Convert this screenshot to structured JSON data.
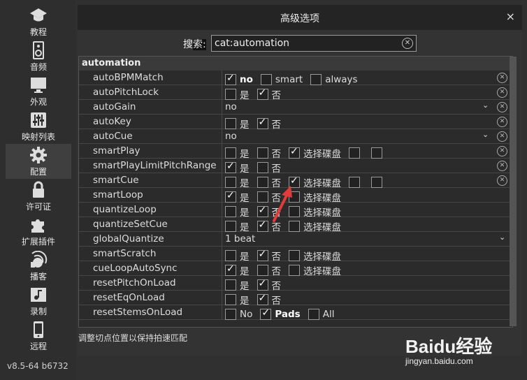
{
  "sidebar": {
    "items": [
      {
        "label": "教程",
        "icon": "graduation-cap-icon"
      },
      {
        "label": "音频",
        "icon": "speaker-icon"
      },
      {
        "label": "外观",
        "icon": "monitor-icon"
      },
      {
        "label": "映射列表",
        "icon": "sliders-icon"
      },
      {
        "label": "配置",
        "icon": "gear-icon"
      },
      {
        "label": "许可证",
        "icon": "lock-icon"
      },
      {
        "label": "扩展插件",
        "icon": "puzzle-icon"
      },
      {
        "label": "播客",
        "icon": "podcast-icon"
      },
      {
        "label": "录制",
        "icon": "music-note-icon"
      },
      {
        "label": "远程",
        "icon": "phone-icon"
      }
    ],
    "active_index": 4,
    "version": "v8.5-64 b6732"
  },
  "dialog": {
    "title": "高级选项",
    "close": "×",
    "search_label_a": "搜",
    "search_label_b": "索:",
    "search_value": "cat:automation",
    "clear": "ⓧ"
  },
  "group": "automation",
  "rows": [
    {
      "name": "autoBPMMatch",
      "type": "opts",
      "opts": [
        {
          "cb": true,
          "text": "no",
          "bold": true
        },
        {
          "cb": false,
          "text": "smart"
        },
        {
          "cb": false,
          "text": "always"
        }
      ],
      "clear": true
    },
    {
      "name": "autoPitchLock",
      "type": "opts",
      "opts": [
        {
          "cb": false,
          "text": "是"
        },
        {
          "cb": true,
          "text": "否"
        }
      ],
      "clear": true
    },
    {
      "name": "autoGain",
      "type": "dropdown",
      "value": "no",
      "clear": true
    },
    {
      "name": "autoKey",
      "type": "opts",
      "opts": [
        {
          "cb": false,
          "text": "是"
        },
        {
          "cb": true,
          "text": "否"
        }
      ],
      "clear": true
    },
    {
      "name": "autoCue",
      "type": "dropdown",
      "value": "no",
      "clear": true
    },
    {
      "name": "smartPlay",
      "type": "opts",
      "opts": [
        {
          "cb": false,
          "text": "是"
        },
        {
          "cb": false,
          "text": "否"
        },
        {
          "cb": true,
          "text": "选择碟盘"
        },
        {
          "cb": false,
          "text": ""
        },
        {
          "cb": false,
          "text": ""
        }
      ],
      "clear": true
    },
    {
      "name": "smartPlayLimitPitchRange",
      "type": "opts",
      "opts": [
        {
          "cb": true,
          "text": "是"
        },
        {
          "cb": false,
          "text": "否"
        }
      ],
      "clear": true
    },
    {
      "name": "smartCue",
      "type": "opts",
      "opts": [
        {
          "cb": false,
          "text": "是"
        },
        {
          "cb": false,
          "text": "否"
        },
        {
          "cb": true,
          "text": "选择碟盘"
        },
        {
          "cb": false,
          "text": ""
        },
        {
          "cb": false,
          "text": ""
        }
      ],
      "clear": true
    },
    {
      "name": "smartLoop",
      "type": "opts",
      "opts": [
        {
          "cb": true,
          "text": "是"
        },
        {
          "cb": false,
          "text": "否"
        },
        {
          "cb": false,
          "text": "选择碟盘"
        }
      ],
      "clear": false
    },
    {
      "name": "quantizeLoop",
      "type": "opts",
      "opts": [
        {
          "cb": false,
          "text": "是"
        },
        {
          "cb": true,
          "text": "否"
        },
        {
          "cb": false,
          "text": "选择碟盘"
        }
      ],
      "clear": false
    },
    {
      "name": "quantizeSetCue",
      "type": "opts",
      "opts": [
        {
          "cb": false,
          "text": "是"
        },
        {
          "cb": true,
          "text": "否"
        },
        {
          "cb": false,
          "text": "选择碟盘"
        }
      ],
      "clear": false
    },
    {
      "name": "globalQuantize",
      "type": "dropdown",
      "value": "1 beat",
      "clear": false
    },
    {
      "name": "smartScratch",
      "type": "opts",
      "opts": [
        {
          "cb": false,
          "text": "是"
        },
        {
          "cb": true,
          "text": "否"
        },
        {
          "cb": false,
          "text": "选择碟盘"
        }
      ],
      "clear": false
    },
    {
      "name": "cueLoopAutoSync",
      "type": "opts",
      "opts": [
        {
          "cb": true,
          "text": "是"
        },
        {
          "cb": false,
          "text": "否"
        },
        {
          "cb": false,
          "text": "选择碟盘"
        }
      ],
      "clear": false
    },
    {
      "name": "resetPitchOnLoad",
      "type": "opts",
      "opts": [
        {
          "cb": false,
          "text": "是"
        },
        {
          "cb": true,
          "text": "否"
        }
      ],
      "clear": false
    },
    {
      "name": "resetEqOnLoad",
      "type": "opts",
      "opts": [
        {
          "cb": false,
          "text": "是"
        },
        {
          "cb": true,
          "text": "否"
        }
      ],
      "clear": false
    },
    {
      "name": "resetStemsOnLoad",
      "type": "opts",
      "opts": [
        {
          "cb": false,
          "text": "No"
        },
        {
          "cb": true,
          "text": "Pads",
          "bold": true
        },
        {
          "cb": false,
          "text": "All"
        }
      ],
      "clear": false
    }
  ],
  "hint": "调整切点位置以保持拍速匹配",
  "watermark": {
    "logo": "Baidu经验",
    "sub": "jingyan.baidu.com"
  }
}
